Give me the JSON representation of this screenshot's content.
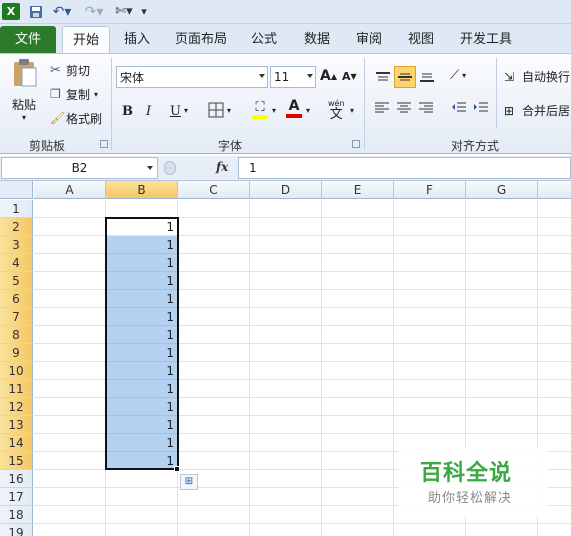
{
  "qat": {
    "icons": [
      "excel-logo-icon",
      "save-icon",
      "undo-icon",
      "redo-icon",
      "customize-icon"
    ]
  },
  "tabs": [
    "文件",
    "开始",
    "插入",
    "页面布局",
    "公式",
    "数据",
    "审阅",
    "视图",
    "开发工具"
  ],
  "ribbon": {
    "clipboard": {
      "paste": "粘贴",
      "cut": "剪切",
      "copy": "复制",
      "format_painter": "格式刷",
      "label": "剪贴板"
    },
    "font": {
      "name": "宋体",
      "size": "11",
      "label": "字体",
      "bold": "B",
      "italic": "I",
      "underline": "U",
      "grow": "A",
      "shrink": "A",
      "wen": "wén",
      "wen_char": "文"
    },
    "align": {
      "wrap": "自动换行",
      "merge": "合并后居",
      "label": "对齐方式"
    }
  },
  "formula_bar": {
    "name_box": "B2",
    "fx": "fx",
    "value": "1"
  },
  "columns": [
    "A",
    "B",
    "C",
    "D",
    "E",
    "F",
    "G"
  ],
  "rows": [
    "1",
    "2",
    "3",
    "4",
    "5",
    "6",
    "7",
    "8",
    "9",
    "10",
    "11",
    "12",
    "13",
    "14",
    "15",
    "16",
    "17",
    "18",
    "19"
  ],
  "b_values": [
    "1",
    "1",
    "1",
    "1",
    "1",
    "1",
    "1",
    "1",
    "1",
    "1",
    "1",
    "1",
    "1",
    "1"
  ],
  "watermark": {
    "title": "百科全说",
    "subtitle": "助你轻松解决"
  }
}
